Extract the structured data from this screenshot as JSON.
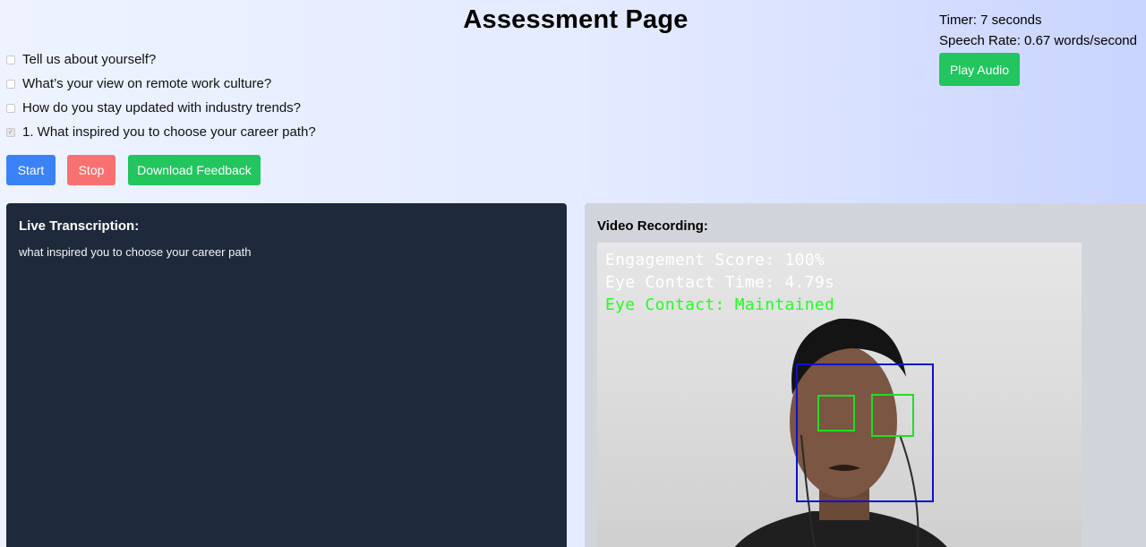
{
  "header": {
    "title": "Assessment Page"
  },
  "stats": {
    "timer": "Timer: 7 seconds",
    "speech_rate": "Speech Rate: 0.67 words/second",
    "play_audio_label": "Play Audio"
  },
  "questions": [
    {
      "text": "Tell us about yourself?",
      "checked": false
    },
    {
      "text": "What’s your view on remote work culture?",
      "checked": false
    },
    {
      "text": "How do you stay updated with industry trends?",
      "checked": false
    },
    {
      "text": "1. What inspired you to choose your career path?",
      "checked": true
    }
  ],
  "controls": {
    "start_label": "Start",
    "stop_label": "Stop",
    "download_label": "Download Feedback"
  },
  "transcription": {
    "heading": "Live Transcription:",
    "text": "what inspired you to choose your career path"
  },
  "video": {
    "heading": "Video Recording:",
    "engagement": "Engagement Score: 100%",
    "eye_contact_time": "Eye Contact Time: 4.79s",
    "eye_contact_status": "Eye Contact: Maintained"
  },
  "colors": {
    "start": "#3b82f6",
    "stop": "#f87171",
    "download": "#22c55e",
    "transcript_bg": "#1e293b",
    "face_box": "#1010d0",
    "eye_box": "#22dd22"
  }
}
